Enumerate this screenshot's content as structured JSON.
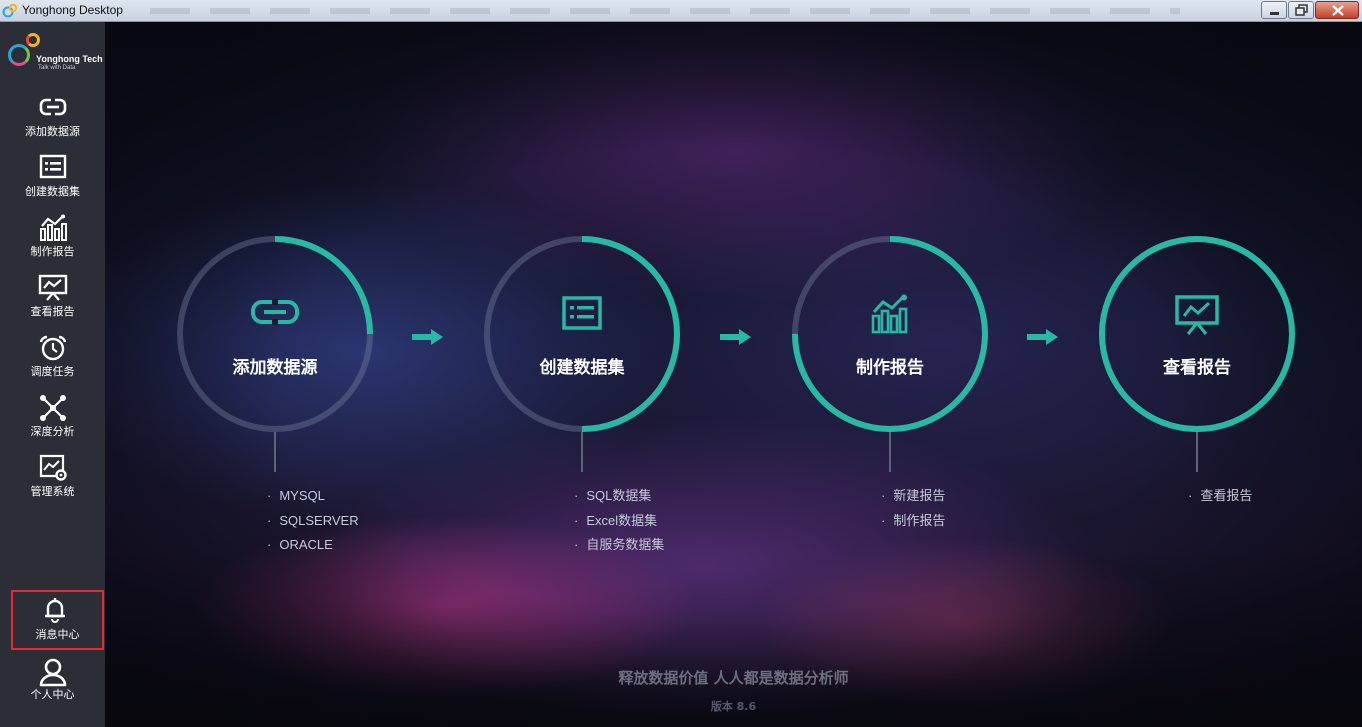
{
  "window": {
    "title": "Yonghong Desktop",
    "controls": [
      "minimize",
      "maximize",
      "close"
    ]
  },
  "logo": {
    "name": "Yonghong Tech",
    "tagline": "Talk with Data"
  },
  "sidebar": {
    "items": [
      {
        "label": "添加数据源",
        "icon": "link-icon"
      },
      {
        "label": "创建数据集",
        "icon": "dataset-list-icon"
      },
      {
        "label": "制作报告",
        "icon": "bar-chart-icon"
      },
      {
        "label": "查看报告",
        "icon": "presentation-icon"
      },
      {
        "label": "调度任务",
        "icon": "alarm-clock-icon"
      },
      {
        "label": "深度分析",
        "icon": "network-icon"
      },
      {
        "label": "管理系统",
        "icon": "settings-monitor-icon"
      }
    ],
    "notification": {
      "label": "消息中心",
      "icon": "bell-icon"
    },
    "profile": {
      "label": "个人中心",
      "icon": "user-icon"
    }
  },
  "workflow": {
    "accent_color": "#28b9a4",
    "steps": [
      {
        "title": "添加数据源",
        "icon": "link-icon",
        "progress": 0.25,
        "links": [
          "MYSQL",
          "SQLSERVER",
          "ORACLE"
        ]
      },
      {
        "title": "创建数据集",
        "icon": "dataset-list-icon",
        "progress": 0.5,
        "links": [
          "SQL数据集",
          "Excel数据集",
          "自服务数据集"
        ]
      },
      {
        "title": "制作报告",
        "icon": "bar-chart-icon",
        "progress": 0.75,
        "links": [
          "新建报告",
          "制作报告"
        ]
      },
      {
        "title": "查看报告",
        "icon": "presentation-icon",
        "progress": 1.0,
        "links": [
          "查看报告"
        ]
      }
    ]
  },
  "footer": {
    "slogan": "释放数据价值 人人都是数据分析师",
    "version": "版本 8.6"
  }
}
